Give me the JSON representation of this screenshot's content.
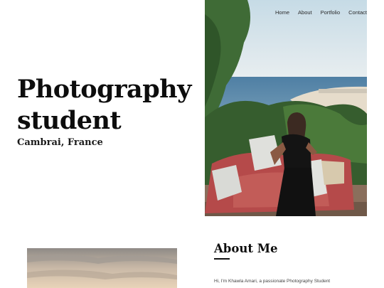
{
  "nav": {
    "items": [
      {
        "label": "Home"
      },
      {
        "label": "About"
      },
      {
        "label": "Portfolio"
      },
      {
        "label": "Contact"
      }
    ]
  },
  "hero": {
    "title_line1": "Photography",
    "title_line2": "student",
    "location": "Cambrai, France"
  },
  "about": {
    "heading": "About Me",
    "intro": "Hi, I'm Khawla Amari, a passionate Photography Student"
  },
  "colors": {
    "text": "#0d0d0d",
    "nav_text": "#2b2b2b",
    "body_text": "#444444",
    "background": "#ffffff"
  }
}
